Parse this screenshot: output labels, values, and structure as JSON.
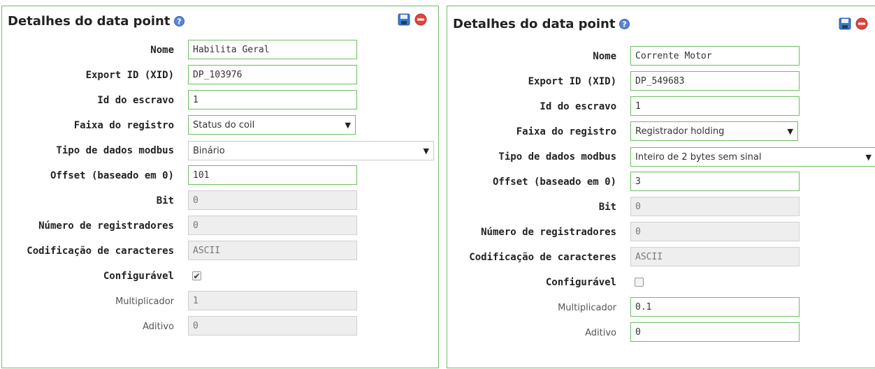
{
  "left": {
    "title": "Detalhes do data point",
    "labels": {
      "name": "Nome",
      "xid": "Export ID (XID)",
      "slave": "Id do escravo",
      "range": "Faixa do registro",
      "datatype": "Tipo de dados modbus",
      "offset": "Offset (baseado em 0)",
      "bit": "Bit",
      "regcount": "Número de registradores",
      "charset": "Codificação de caracteres",
      "settable": "Configurável",
      "multiplier": "Multiplicador",
      "additive": "Aditivo"
    },
    "values": {
      "name": "Habilita Geral",
      "xid": "DP_103976",
      "slave": "1",
      "range": "Status do coil",
      "datatype": "Binário",
      "offset": "101",
      "bit": "0",
      "regcount": "0",
      "charset": "ASCII",
      "settable_check": "✔",
      "multiplier": "1",
      "additive": "0"
    }
  },
  "right": {
    "title": "Detalhes do data point",
    "labels": {
      "name": "Nome",
      "xid": "Export ID (XID)",
      "slave": "Id do escravo",
      "range": "Faixa do registro",
      "datatype": "Tipo de dados modbus",
      "offset": "Offset (baseado em 0)",
      "bit": "Bit",
      "regcount": "Número de registradores",
      "charset": "Codificação de caracteres",
      "settable": "Configurável",
      "multiplier": "Multiplicador",
      "additive": "Aditivo"
    },
    "values": {
      "name": "Corrente Motor",
      "xid": "DP_549683",
      "slave": "1",
      "range": "Registrador holding",
      "datatype": "Inteiro de 2 bytes sem sinal",
      "offset": "3",
      "bit": "0",
      "regcount": "0",
      "charset": "ASCII",
      "settable_check": "",
      "multiplier": "0.1",
      "additive": "0"
    }
  },
  "colors": {
    "accent_border": "#6dbf62",
    "disabled_bg": "#eeeeee"
  },
  "icons": {
    "help": "help-icon",
    "save": "save-icon",
    "close": "close-icon",
    "caret": "caret-down-icon"
  }
}
